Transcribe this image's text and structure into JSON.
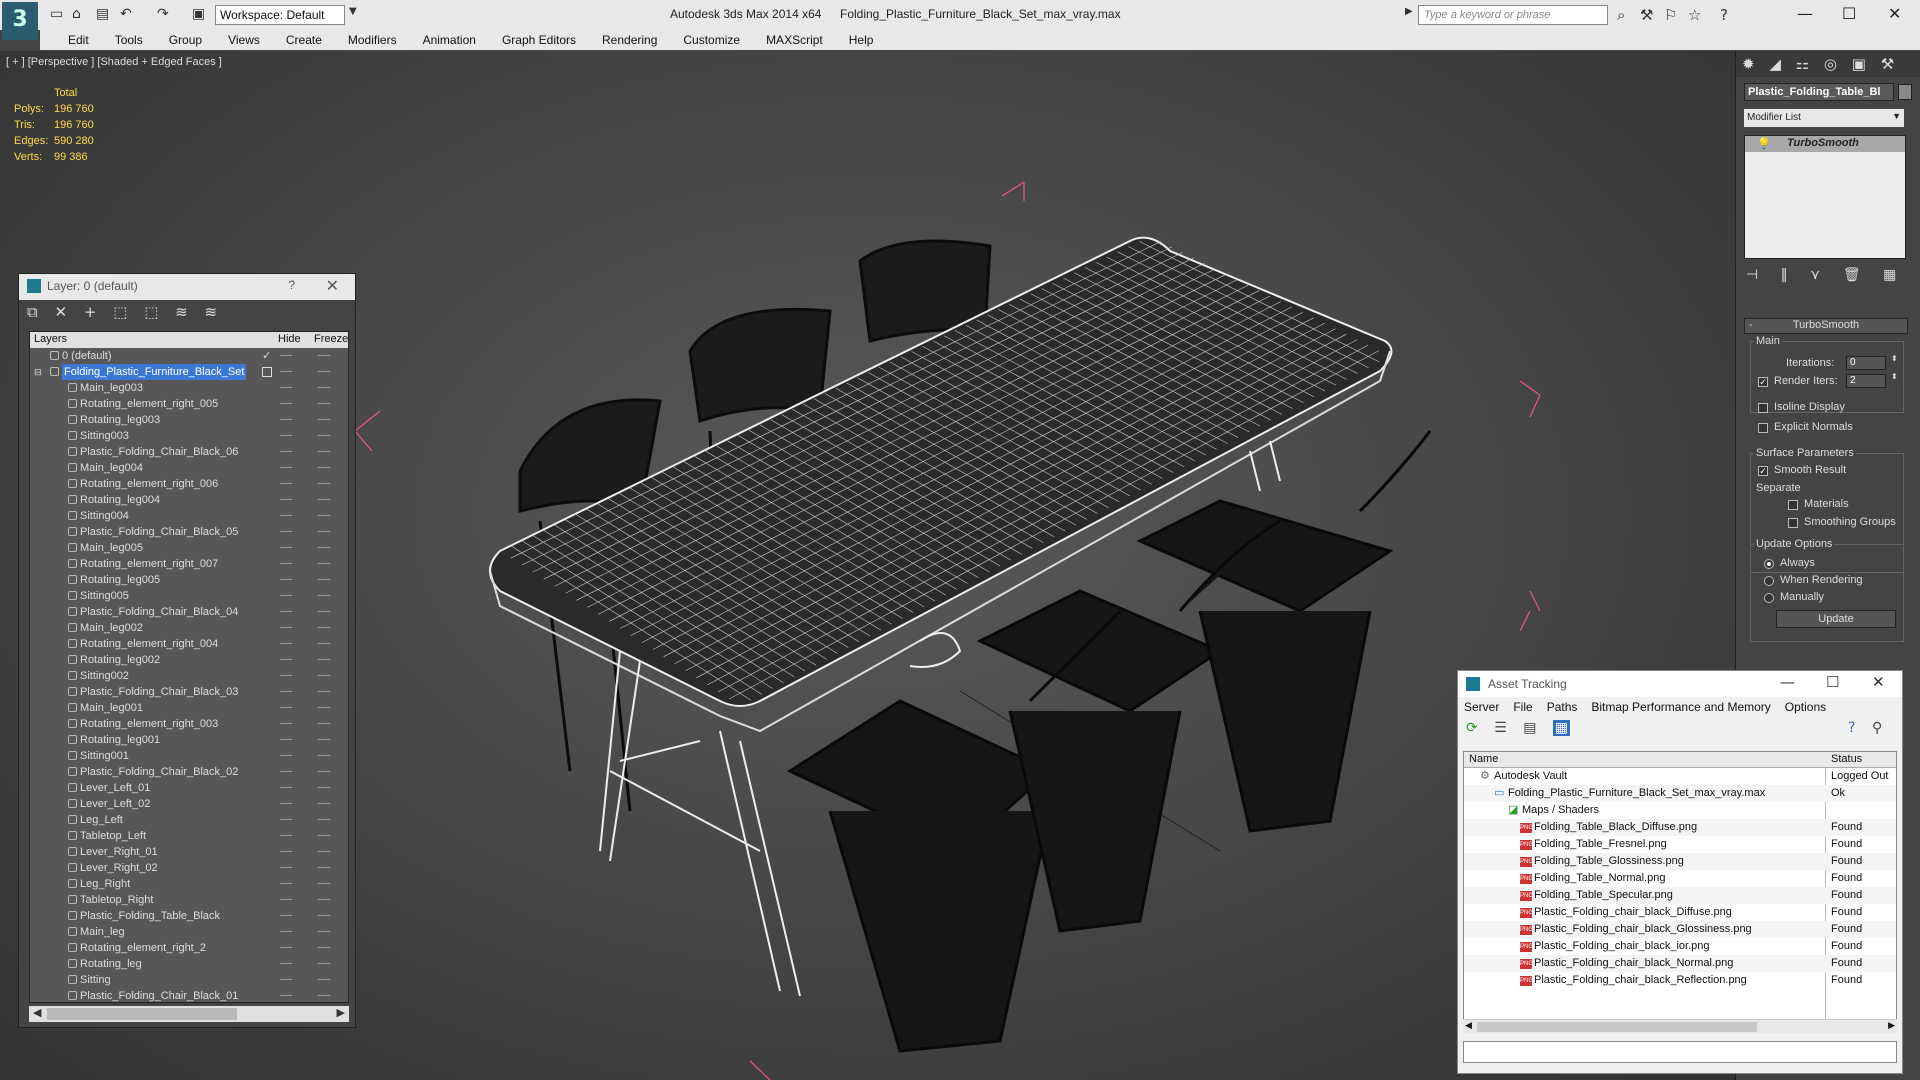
{
  "titlebar": {
    "app": "Autodesk 3ds Max  2014 x64",
    "file": "Folding_Plastic_Furniture_Black_Set_max_vray.max",
    "workspace": "Workspace: Default",
    "search_placeholder": "Type a keyword or phrase"
  },
  "menu": [
    "Edit",
    "Tools",
    "Group",
    "Views",
    "Create",
    "Modifiers",
    "Animation",
    "Graph Editors",
    "Rendering",
    "Customize",
    "MAXScript",
    "Help"
  ],
  "viewport": {
    "label": "[ + ] [Perspective ] [Shaded + Edged Faces ]",
    "stats": {
      "header": "Total",
      "rows": [
        {
          "label": "Polys:",
          "value": "196 760"
        },
        {
          "label": "Tris:",
          "value": "196 760"
        },
        {
          "label": "Edges:",
          "value": "590 280"
        },
        {
          "label": "Verts:",
          "value": "99 386"
        }
      ]
    }
  },
  "layer_panel": {
    "title": "Layer: 0 (default)",
    "help": "?",
    "columns": {
      "layers": "Layers",
      "hide": "Hide",
      "freeze": "Freeze"
    },
    "top_layers": [
      "0 (default)",
      "Folding_Plastic_Furniture_Black_Set"
    ],
    "items": [
      "Main_leg003",
      "Rotating_element_right_005",
      "Rotating_leg003",
      "Sitting003",
      "Plastic_Folding_Chair_Black_06",
      "Main_leg004",
      "Rotating_element_right_006",
      "Rotating_leg004",
      "Sitting004",
      "Plastic_Folding_Chair_Black_05",
      "Main_leg005",
      "Rotating_element_right_007",
      "Rotating_leg005",
      "Sitting005",
      "Plastic_Folding_Chair_Black_04",
      "Main_leg002",
      "Rotating_element_right_004",
      "Rotating_leg002",
      "Sitting002",
      "Plastic_Folding_Chair_Black_03",
      "Main_leg001",
      "Rotating_element_right_003",
      "Rotating_leg001",
      "Sitting001",
      "Plastic_Folding_Chair_Black_02",
      "Lever_Left_01",
      "Lever_Left_02",
      "Leg_Left",
      "Tabletop_Left",
      "Lever_Right_01",
      "Lever_Right_02",
      "Leg_Right",
      "Tabletop_Right",
      "Plastic_Folding_Table_Black",
      "Main_leg",
      "Rotating_element_right_2",
      "Rotating_leg",
      "Sitting",
      "Plastic_Folding_Chair_Black_01",
      "Folding_Plastic_Furniture_Black_Set"
    ]
  },
  "command_panel": {
    "object_name": "Plastic_Folding_Table_Bl",
    "modifier_list": "Modifier List",
    "stack_item": "TurboSmooth",
    "rollout": "TurboSmooth",
    "main_label": "Main",
    "iterations_label": "Iterations:",
    "iterations": "0",
    "render_iters_label": "Render Iters:",
    "render_iters": "2",
    "isoline": "Isoline Display",
    "explicit": "Explicit Normals",
    "surface_label": "Surface Parameters",
    "smooth_result": "Smooth Result",
    "separate_label": "Separate",
    "materials": "Materials",
    "smoothing_groups": "Smoothing Groups",
    "update_label": "Update Options",
    "always": "Always",
    "when_rendering": "When Rendering",
    "manually": "Manually",
    "update_btn": "Update"
  },
  "asset": {
    "title": "Asset Tracking",
    "menu": [
      "Server",
      "File",
      "Paths",
      "Bitmap Performance and Memory",
      "Options"
    ],
    "columns": {
      "name": "Name",
      "status": "Status"
    },
    "vault": {
      "name": "Autodesk Vault",
      "status": "Logged Out"
    },
    "maxfile": {
      "name": "Folding_Plastic_Furniture_Black_Set_max_vray.max",
      "status": "Ok"
    },
    "maps": {
      "name": "Maps / Shaders",
      "status": ""
    },
    "files": [
      {
        "name": "Folding_Table_Black_Diffuse.png",
        "status": "Found"
      },
      {
        "name": "Folding_Table_Fresnel.png",
        "status": "Found"
      },
      {
        "name": "Folding_Table_Glossiness.png",
        "status": "Found"
      },
      {
        "name": "Folding_Table_Normal.png",
        "status": "Found"
      },
      {
        "name": "Folding_Table_Specular.png",
        "status": "Found"
      },
      {
        "name": "Plastic_Folding_chair_black_Diffuse.png",
        "status": "Found"
      },
      {
        "name": "Plastic_Folding_chair_black_Glossiness.png",
        "status": "Found"
      },
      {
        "name": "Plastic_Folding_chair_black_ior.png",
        "status": "Found"
      },
      {
        "name": "Plastic_Folding_chair_black_Normal.png",
        "status": "Found"
      },
      {
        "name": "Plastic_Folding_chair_black_Reflection.png",
        "status": "Found"
      }
    ]
  }
}
